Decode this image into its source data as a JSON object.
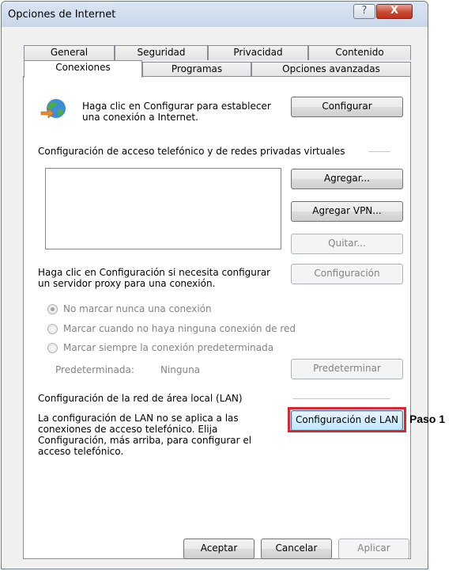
{
  "window": {
    "title": "Opciones de Internet",
    "help_glyph": "?",
    "close_glyph": "X"
  },
  "tabs": {
    "row1": [
      "General",
      "Seguridad",
      "Privacidad",
      "Contenido"
    ],
    "row2": [
      "Conexiones",
      "Programas",
      "Opciones avanzadas"
    ],
    "active": "Conexiones"
  },
  "setup": {
    "text_line1": "Haga clic en Configurar para establecer",
    "text_line2": "una conexión a Internet.",
    "button": "Configurar",
    "icon": "globe-connection-icon"
  },
  "dialup": {
    "heading": "Configuración de acceso telefónico y de redes privadas virtuales",
    "add_button": "Agregar...",
    "add_vpn_button": "Agregar VPN...",
    "remove_button": "Quitar...",
    "proxy_text_line1": "Haga clic en Configuración si necesita configurar",
    "proxy_text_line2": "un servidor proxy para una conexión.",
    "settings_button": "Configuración",
    "radios": [
      {
        "label": "No marcar nunca una conexión",
        "selected": true
      },
      {
        "label": "Marcar cuando no haya ninguna conexión de red",
        "selected": false
      },
      {
        "label": "Marcar siempre la conexión predeterminada",
        "selected": false
      }
    ],
    "default_label": "Predeterminada:",
    "default_value": "Ninguna",
    "set_default_button": "Predeterminar"
  },
  "lan": {
    "heading": "Configuración de la red de área local (LAN)",
    "text_line1": "La configuración de LAN no se aplica a las",
    "text_line2": "conexiones de acceso telefónico. Elija",
    "text_line3": "Configuración, más arriba, para configurar el",
    "text_line4": "acceso telefónico.",
    "button": "Configuración de LAN",
    "annotation": "Paso 1",
    "highlight_color": "#e0242d"
  },
  "footer": {
    "ok": "Aceptar",
    "cancel": "Cancelar",
    "apply": "Aplicar"
  }
}
